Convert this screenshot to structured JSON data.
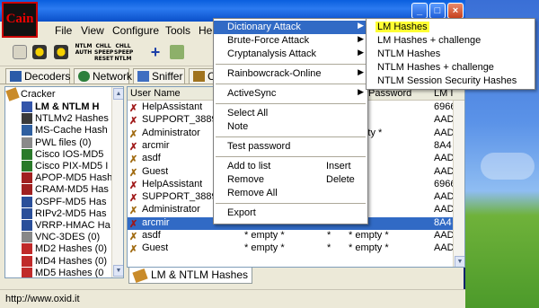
{
  "menubar": {
    "items": [
      "File",
      "View",
      "Configure",
      "Tools",
      "Hel"
    ]
  },
  "toolbar": {
    "labels": [
      "NTLM AUTH",
      "CHLL SPEEP RESET",
      "CHLL SPEEP NTLM"
    ]
  },
  "tabs": [
    {
      "label": "Decoders",
      "icon": "decoder-icon"
    },
    {
      "label": "Network",
      "icon": "network-icon"
    },
    {
      "label": "Sniffer",
      "icon": "sniffer-icon"
    },
    {
      "label": "C",
      "icon": "cracker-icon"
    }
  ],
  "tree": {
    "root": "Cracker",
    "items": [
      {
        "label": "LM & NTLM H",
        "bold": true
      },
      {
        "label": "NTLMv2 Hashes"
      },
      {
        "label": "MS-Cache Hash"
      },
      {
        "label": "PWL files (0)"
      },
      {
        "label": "Cisco IOS-MD5"
      },
      {
        "label": "Cisco PIX-MD5 I"
      },
      {
        "label": "APOP-MD5 Hash"
      },
      {
        "label": "CRAM-MD5 Has"
      },
      {
        "label": "OSPF-MD5 Has"
      },
      {
        "label": "RIPv2-MD5 Has"
      },
      {
        "label": "VRRP-HMAC Ha"
      },
      {
        "label": "VNC-3DES (0)"
      },
      {
        "label": "MD2 Hashes (0)"
      },
      {
        "label": "MD4 Hashes (0)"
      },
      {
        "label": "MD5 Hashes (0"
      }
    ]
  },
  "table": {
    "columns": [
      "User Name",
      "Password",
      "LM I"
    ],
    "rows": [
      {
        "user": "HelpAssistant",
        "c2": "",
        "c3": "",
        "c4": "",
        "lm": "6966"
      },
      {
        "user": "SUPPORT_38894",
        "c2": "",
        "c3": "",
        "c4": "",
        "lm": "AAD"
      },
      {
        "user": "Administrator",
        "c2": "",
        "c3": "",
        "c4": "empty *",
        "lm": "AAD"
      },
      {
        "user": "arcmir",
        "c2": "",
        "c3": "",
        "c4": "",
        "lm": "8A4"
      },
      {
        "user": "asdf",
        "c2": "",
        "c3": "",
        "c4": "",
        "lm": "AAD"
      },
      {
        "user": "Guest",
        "c2": "",
        "c3": "",
        "c4": "",
        "lm": "AAD"
      },
      {
        "user": "HelpAssistant",
        "c2": "",
        "c3": "",
        "c4": "",
        "lm": "6966"
      },
      {
        "user": "SUPPORT_38894",
        "c2": "",
        "c3": "",
        "c4": "",
        "lm": "AAD"
      },
      {
        "user": "Administrator",
        "c2": "",
        "c3": "",
        "c4": "",
        "lm": "AAD"
      },
      {
        "user": "arcmir",
        "c2": "",
        "c3": "",
        "c4": "",
        "lm": "8A4"
      },
      {
        "user": "asdf",
        "c2": "* empty *",
        "c3": "*",
        "c4": "* empty *",
        "lm": "AAD"
      },
      {
        "user": "Guest",
        "c2": "* empty *",
        "c3": "*",
        "c4": "* empty *",
        "lm": "AAD"
      }
    ]
  },
  "bottom_tab": "LM & NTLM Hashes",
  "status": "http://www.oxid.it",
  "context_menu": {
    "items": [
      {
        "label": "Dictionary Attack",
        "arrow": true,
        "highlight": true
      },
      {
        "label": "Brute-Force Attack",
        "arrow": true
      },
      {
        "label": "Cryptanalysis Attack",
        "arrow": true
      },
      {
        "sep": true
      },
      {
        "label": "Rainbowcrack-Online",
        "arrow": true
      },
      {
        "sep": true
      },
      {
        "label": "ActiveSync",
        "arrow": true
      },
      {
        "sep": true
      },
      {
        "label": "Select All"
      },
      {
        "label": "Note"
      },
      {
        "sep": true
      },
      {
        "label": "Test password"
      },
      {
        "sep": true
      },
      {
        "label": "Add to list",
        "shortcut": "Insert"
      },
      {
        "label": "Remove",
        "shortcut": "Delete"
      },
      {
        "label": "Remove All"
      },
      {
        "sep": true
      },
      {
        "label": "Export"
      }
    ]
  },
  "submenu": {
    "items": [
      "LM Hashes",
      "LM Hashes + challenge",
      "NTLM Hashes",
      "NTLM Hashes + challenge",
      "NTLM Session Security Hashes"
    ]
  },
  "colors": {
    "selection": "#316ac5",
    "highlight": "#ffff33"
  }
}
